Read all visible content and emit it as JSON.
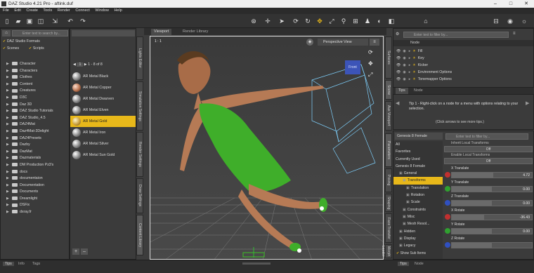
{
  "window": {
    "title": "DAZ Studio 4.21 Pro - aftink.duf"
  },
  "menu": [
    "File",
    "Edit",
    "Create",
    "Tools",
    "Render",
    "Connect",
    "Window",
    "Help"
  ],
  "content_library": {
    "search_placeholder": "Enter text to search by...",
    "formats_label": "DAZ Studio Formats",
    "scenes_label": "Scenes",
    "scripts_label": "Scripts",
    "folders": [
      "Character",
      "Characters",
      "Clothes",
      "Content",
      "Creatures",
      "D3C",
      "Daz 3D",
      "DAZ Studio Tutorials",
      "DAZ Studio_4.5",
      "DAZ4Mat",
      "Daz4Mat-3Delight",
      "DAZ4Presets",
      "Dazby",
      "DazMat",
      "Dazmaterials",
      "DM Production Pz3's",
      "docs",
      "documentaion",
      "Documentation",
      "Documents",
      "Dreamlight",
      "DSFix",
      "dxray.fr"
    ]
  },
  "materials": {
    "pager": "1 - 8 of 8",
    "page_num": "1",
    "items": [
      "AR Metal Black",
      "AR Metal Copper",
      "AR Metal Dwarven",
      "AR Metal Elven",
      "AR Metal Gold",
      "AR Metal Iron",
      "AR Metal Silver",
      "AR Metal Sun Gold"
    ],
    "selected_index": 4
  },
  "left_vtabs": [
    "Lights Editor",
    "Simulation Settings",
    "Render Settings",
    "Draw Settings",
    "Content Library"
  ],
  "viewport": {
    "tabs": [
      "Viewport",
      "Render Library"
    ],
    "view_label": "Perspective View",
    "frame_label": "1 : 1",
    "cube_label": "Front"
  },
  "scene_panel": {
    "search_placeholder": "Enter text to filter by...",
    "column": "Node",
    "nodes": [
      "Fill",
      "Key",
      "Kicker",
      "Environment Options",
      "Tonemapper Options"
    ],
    "tabs": [
      "Tips",
      "Node"
    ],
    "tip_text": "Tip 1 - Right-click on a node for a menu with options relating to your selection.",
    "tip_nav": "(Click arrows to see more tips.)"
  },
  "right_vtabs": [
    "Surfaces",
    "Scene",
    "Aux Viewport",
    "Parameters",
    "Posing",
    "Shaping",
    "Face Transfer",
    "Morph Loader"
  ],
  "parameters": {
    "figure": "Genesis 8 Female",
    "search_placeholder": "Enter text to filter by...",
    "tree": [
      {
        "label": "All",
        "indent": 0
      },
      {
        "label": "Favorites",
        "indent": 0
      },
      {
        "label": "Currently Used",
        "indent": 0
      },
      {
        "label": "Genesis 8 Female",
        "indent": 0
      },
      {
        "label": "General",
        "indent": 1
      },
      {
        "label": "Transforms",
        "indent": 2
      },
      {
        "label": "Translation",
        "indent": 3
      },
      {
        "label": "Rotation",
        "indent": 3
      },
      {
        "label": "Scale",
        "indent": 3
      },
      {
        "label": "Constraints",
        "indent": 2
      },
      {
        "label": "Misc",
        "indent": 2
      },
      {
        "label": "Mesh Resol...",
        "indent": 2
      },
      {
        "label": "Hidden",
        "indent": 1
      },
      {
        "label": "Display",
        "indent": 1
      },
      {
        "label": "Legacy",
        "indent": 1
      }
    ],
    "selected_tree": "Transforms",
    "show_sub_items": "Show Sub Items",
    "toggles": [
      {
        "label": "Inherit Local Transforms",
        "value": "Off"
      },
      {
        "label": "Enable Local Transforms",
        "value": "Off"
      }
    ],
    "sliders": [
      {
        "label": "X Translate",
        "value": "4.72",
        "color": "#c03030",
        "fill": 0.52
      },
      {
        "label": "Y Translate",
        "value": "0.00",
        "color": "#30a030",
        "fill": 0.5
      },
      {
        "label": "Z Translate",
        "value": "0.00",
        "color": "#3050c0",
        "fill": 0.5
      },
      {
        "label": "X Rotate",
        "value": "-36.43",
        "color": "#c03030",
        "fill": 0.4
      },
      {
        "label": "Y Rotate",
        "value": "0.00",
        "color": "#30a030",
        "fill": 0.5
      },
      {
        "label": "Z Rotate",
        "value": "",
        "color": "#3050c0",
        "fill": 0.5
      }
    ]
  },
  "bottom_tabs": [
    "Tips",
    "Info",
    "Tags"
  ],
  "bottom_tabs_right": [
    "Tips",
    "Node"
  ]
}
